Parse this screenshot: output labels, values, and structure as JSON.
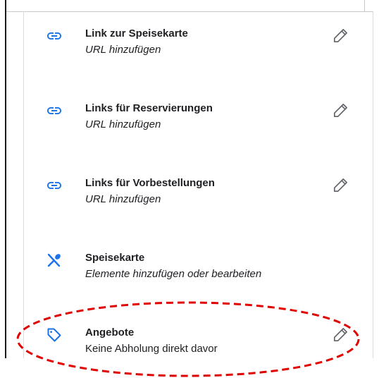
{
  "items": [
    {
      "title": "Link zur Speisekarte",
      "subtitle": "URL hinzufügen",
      "icon": "link-icon",
      "editable": true
    },
    {
      "title": "Links für Reservierungen",
      "subtitle": "URL hinzufügen",
      "icon": "link-icon",
      "editable": true
    },
    {
      "title": "Links für Vorbestellungen",
      "subtitle": "URL hinzufügen",
      "icon": "link-icon",
      "editable": true
    },
    {
      "title": "Speisekarte",
      "subtitle": "Elemente hinzufügen oder bearbeiten",
      "icon": "restaurant-icon",
      "editable": false
    },
    {
      "title": "Angebote",
      "subtitle": "Keine Abholung direkt davor",
      "icon": "tag-icon",
      "editable": true
    }
  ],
  "colors": {
    "icon_blue": "#1a73e8",
    "text": "#202124",
    "highlight": "#e00000"
  }
}
